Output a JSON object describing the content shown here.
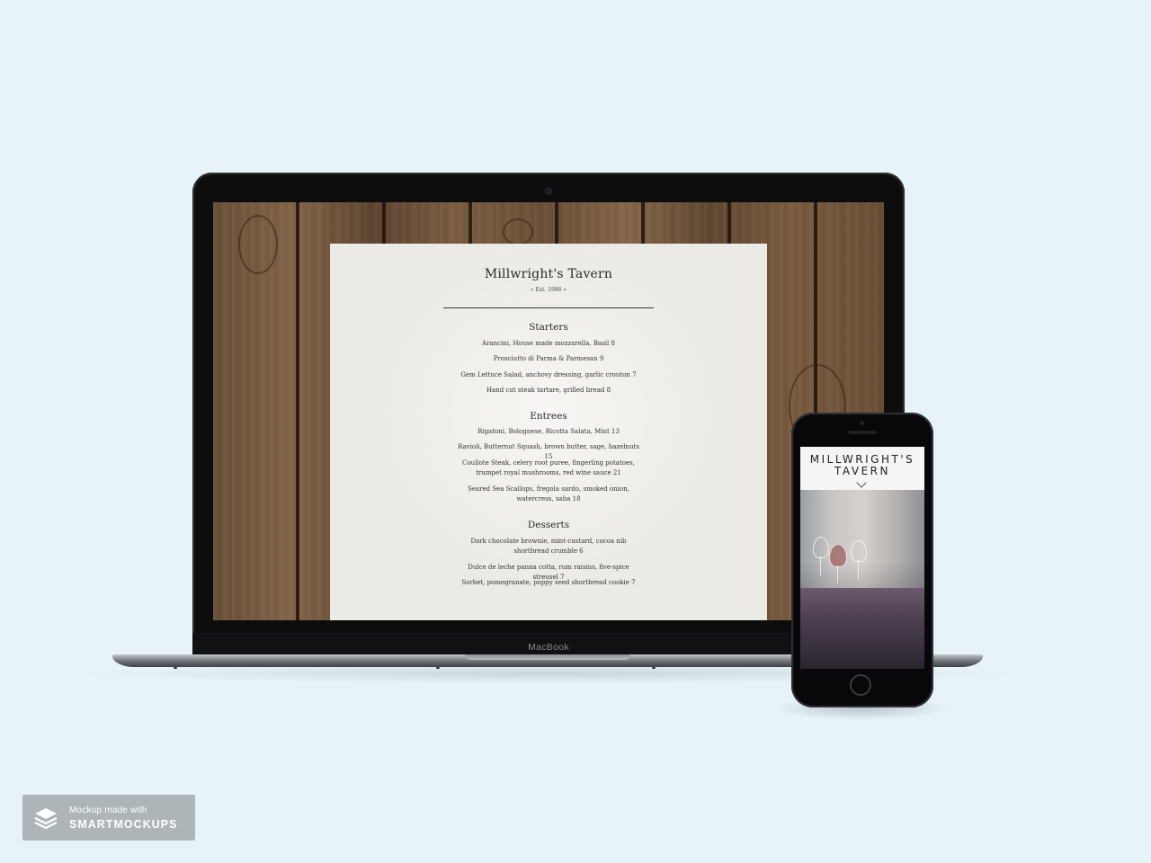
{
  "laptop": {
    "brand_label": "MacBook",
    "menu": {
      "title": "Millwright's Tavern",
      "established": "« Est. 1986 »",
      "sections": [
        {
          "title": "Starters",
          "items": [
            "Arancini, House made mozzarella, Basil 8",
            "Prosciutto di Parma & Parmesan 9",
            "Gem Lettuce Salad, anchovy dressing, garlic crouton 7",
            "Hand cut steak tartare, grilled bread 8"
          ]
        },
        {
          "title": "Entrees",
          "items": [
            "Rigatoni, Bolognese, Ricotta Salata, Mint 13",
            "Ravioli, Butternut Squash, brown butter, sage, hazelnuts 15",
            "Coullote Steak, celery root puree, fingerling potatoes, trumpet royal mushrooms, red wine sauce 21",
            "Seared Sea Scallops, fregola sardo, smoked onion, watercress, saba 18"
          ]
        },
        {
          "title": "Desserts",
          "items": [
            "Dark chocolate brownie, mint-custard, cocoa nib shortbread crumble 6",
            "Dulce de leche panna cotta, rum raisins, five-spice streusel 7",
            "Sorbet, pomegranate, poppy seed shortbread cookie 7"
          ]
        }
      ]
    }
  },
  "phone": {
    "title_line1": "MILLWRIGHT'S",
    "title_line2": "TAVERN",
    "scroll_icon": "chevron-down-icon"
  },
  "badge": {
    "small_text": "Mockup made with",
    "big_text": "SMARTMOCKUPS",
    "icon": "layers-icon"
  },
  "colors": {
    "background": "#e7f3f8",
    "paper": "#ebeae5",
    "wood": "#6a5038",
    "device_black": "#0d0d0e"
  }
}
